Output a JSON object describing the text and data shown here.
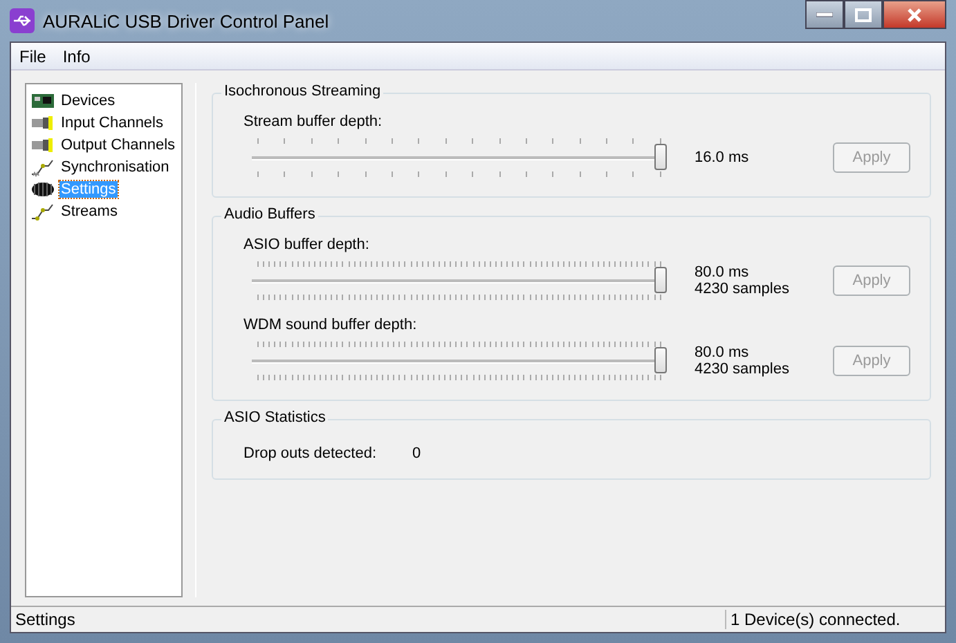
{
  "window": {
    "title": "AURALiC USB Driver Control Panel"
  },
  "menu": [
    "File",
    "Info"
  ],
  "tree": [
    {
      "label": "Devices",
      "kind": "card",
      "selected": false
    },
    {
      "label": "Input Channels",
      "kind": "plug",
      "selected": false
    },
    {
      "label": "Output Channels",
      "kind": "plug",
      "selected": false
    },
    {
      "label": "Synchronisation",
      "kind": "sync",
      "selected": false
    },
    {
      "label": "Settings",
      "kind": "chip",
      "selected": true
    },
    {
      "label": "Streams",
      "kind": "stream",
      "selected": false
    }
  ],
  "groups": [
    {
      "title": "Isochronous Streaming",
      "sliders": [
        {
          "label": "Stream buffer depth:",
          "kind": "coarse",
          "level": 1,
          "reading": [
            "16.0 ms"
          ],
          "button": {
            "label": "Apply",
            "disabled": true
          }
        }
      ]
    },
    {
      "title": "Audio Buffers",
      "sliders": [
        {
          "label": "ASIO buffer depth:",
          "kind": "fine",
          "level": 1,
          "reading": [
            "80.0 ms",
            "4230 samples"
          ],
          "button": {
            "label": "Apply",
            "disabled": true
          }
        },
        {
          "label": "WDM sound buffer depth:",
          "kind": "fine",
          "level": 1,
          "reading": [
            "80.0 ms",
            "4230 samples"
          ],
          "button": {
            "label": "Apply",
            "disabled": true
          }
        }
      ]
    },
    {
      "title": "ASIO Statistics",
      "stats": [
        {
          "label": "Drop outs detected:",
          "value": "0"
        }
      ]
    }
  ],
  "status_bar": [
    "Settings",
    "1 Device(s) connected."
  ]
}
